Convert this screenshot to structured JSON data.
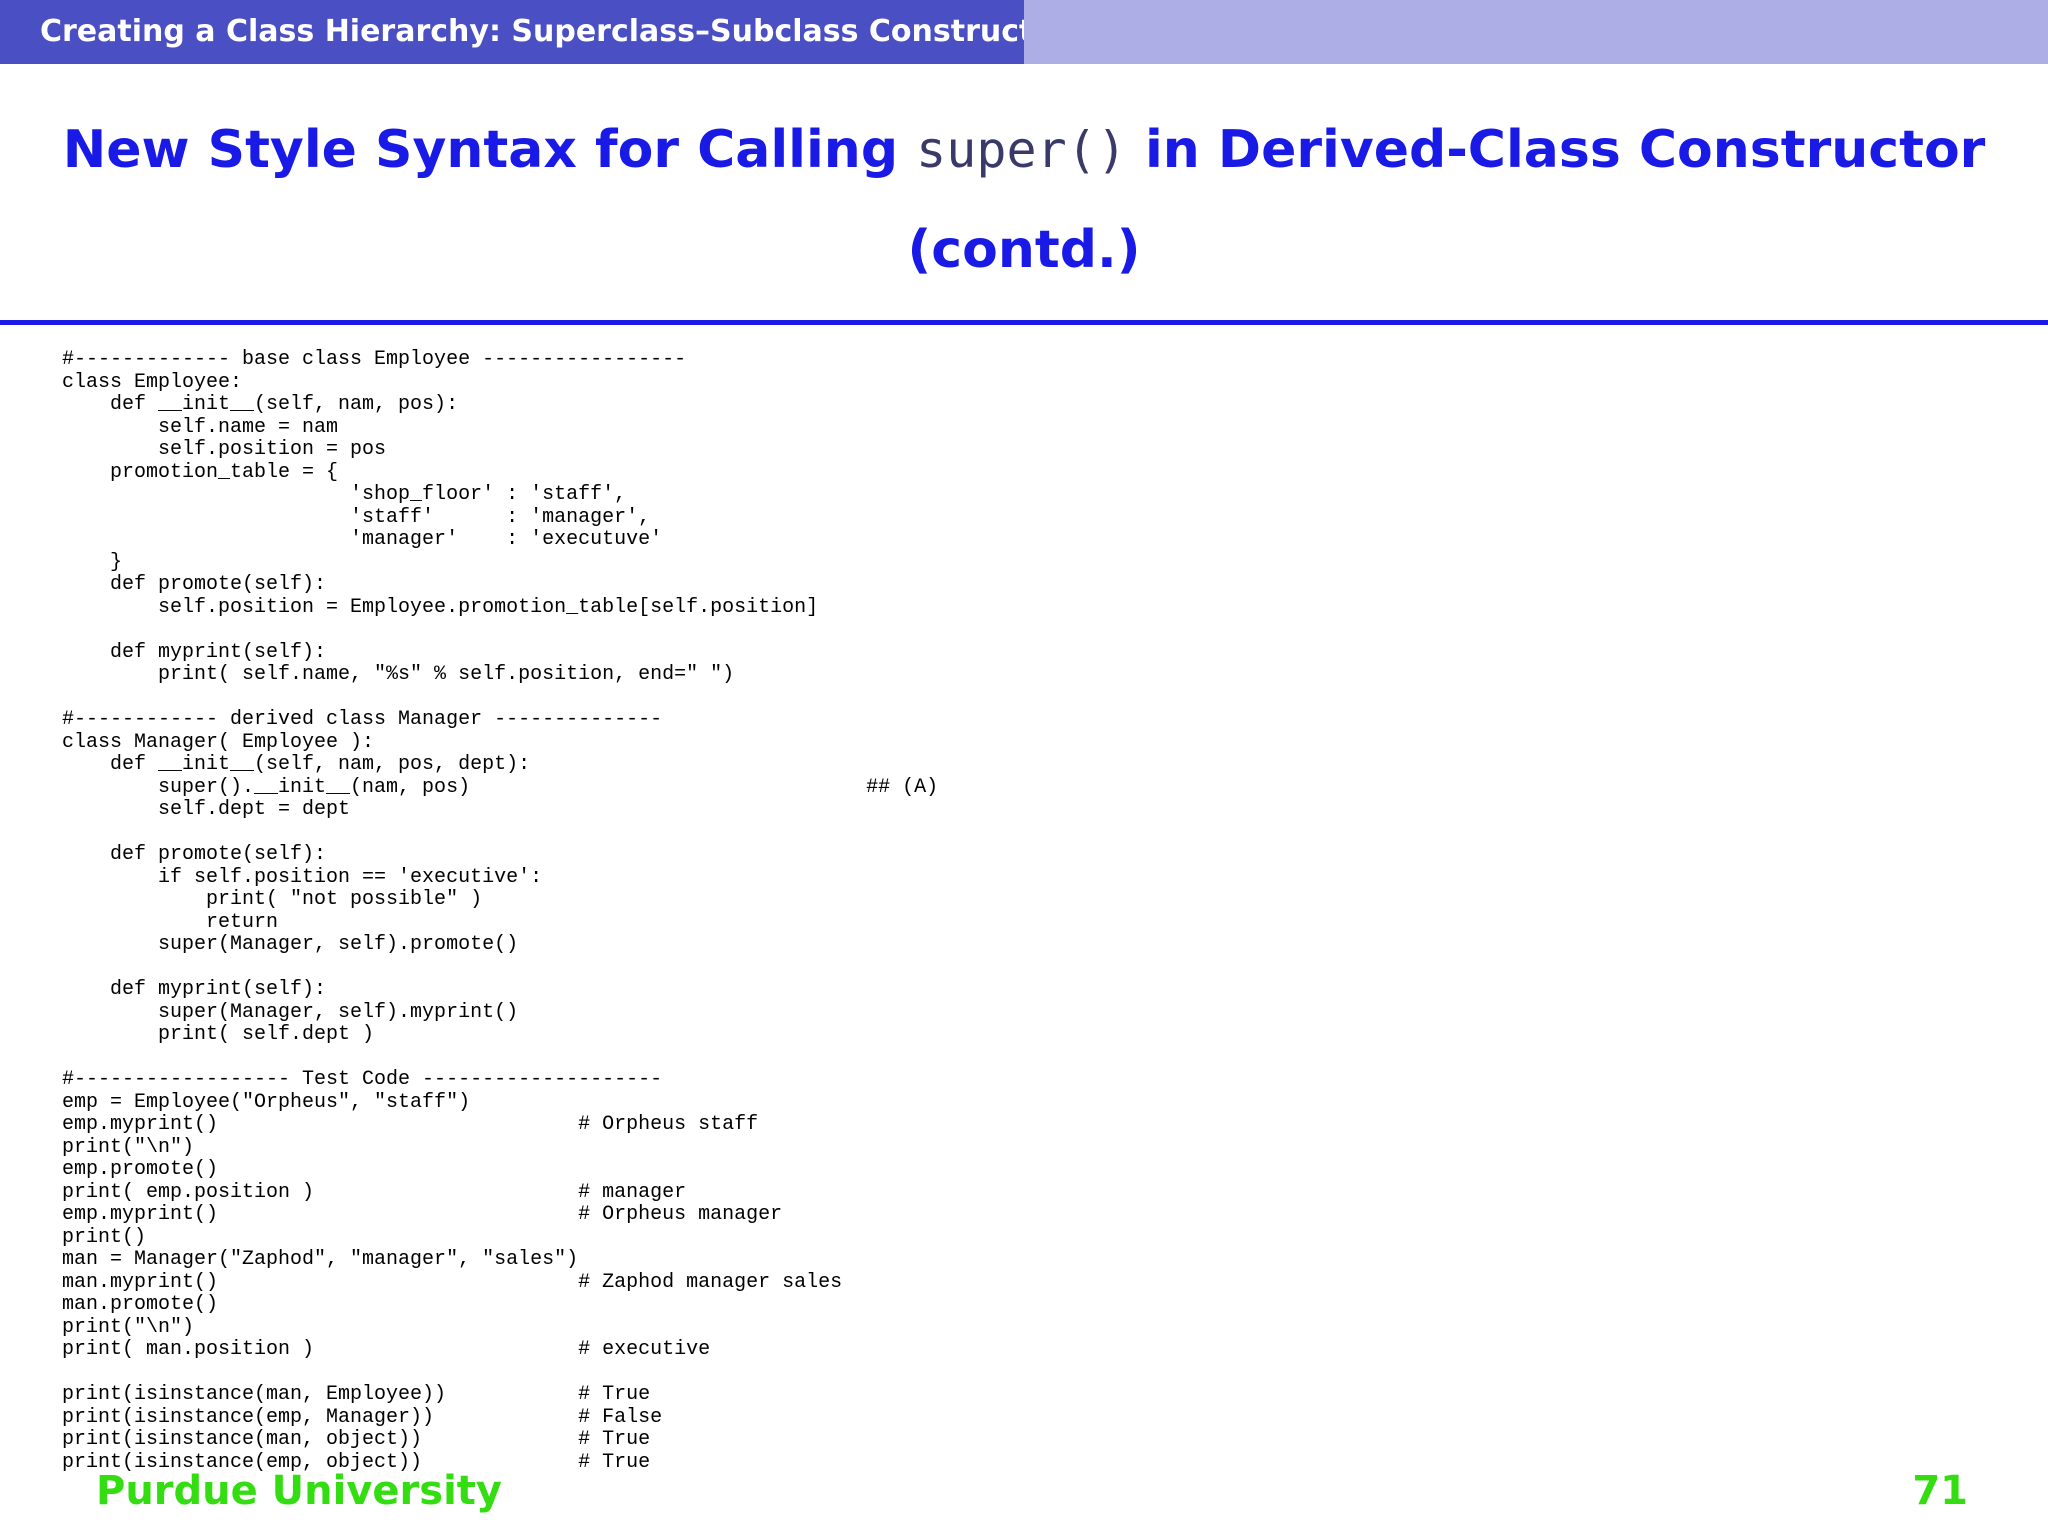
{
  "header": {
    "section_title": "Creating a Class Hierarchy: Superclass–Subclass Constructors"
  },
  "slide": {
    "title_part1": "New Style Syntax for Calling ",
    "title_code": "super()",
    "title_part2": " in Derived-Class Constructor",
    "title_line2": "(contd.)"
  },
  "code_listing": "#------------- base class Employee -----------------\nclass Employee:\n    def __init__(self, nam, pos):\n        self.name = nam\n        self.position = pos\n    promotion_table = {\n                        'shop_floor' : 'staff',\n                        'staff'      : 'manager',\n                        'manager'    : 'executuve'\n    }\n    def promote(self):\n        self.position = Employee.promotion_table[self.position]\n\n    def myprint(self):\n        print( self.name, \"%s\" % self.position, end=\" \")\n\n#------------ derived class Manager --------------\nclass Manager( Employee ):\n    def __init__(self, nam, pos, dept):\n        super().__init__(nam, pos)                                 ## (A)\n        self.dept = dept\n\n    def promote(self):\n        if self.position == 'executive':\n            print( \"not possible\" )\n            return\n        super(Manager, self).promote()\n\n    def myprint(self):\n        super(Manager, self).myprint()\n        print( self.dept )\n\n#------------------ Test Code --------------------\nemp = Employee(\"Orpheus\", \"staff\")\nemp.myprint()                              # Orpheus staff\nprint(\"\\n\")\nemp.promote()\nprint( emp.position )                      # manager\nemp.myprint()                              # Orpheus manager\nprint()\nman = Manager(\"Zaphod\", \"manager\", \"sales\")\nman.myprint()                              # Zaphod manager sales\nman.promote()\nprint(\"\\n\")\nprint( man.position )                      # executive\n\nprint(isinstance(man, Employee))           # True\nprint(isinstance(emp, Manager))            # False\nprint(isinstance(man, object))             # True\nprint(isinstance(emp, object))             # True",
  "footer": {
    "institution": "Purdue University",
    "page_number": "71"
  },
  "colors": {
    "header_bar": "#4a4fc4",
    "header_bar_light": "#adaee6",
    "title": "#1a1ae6",
    "footer": "#33dd11"
  }
}
